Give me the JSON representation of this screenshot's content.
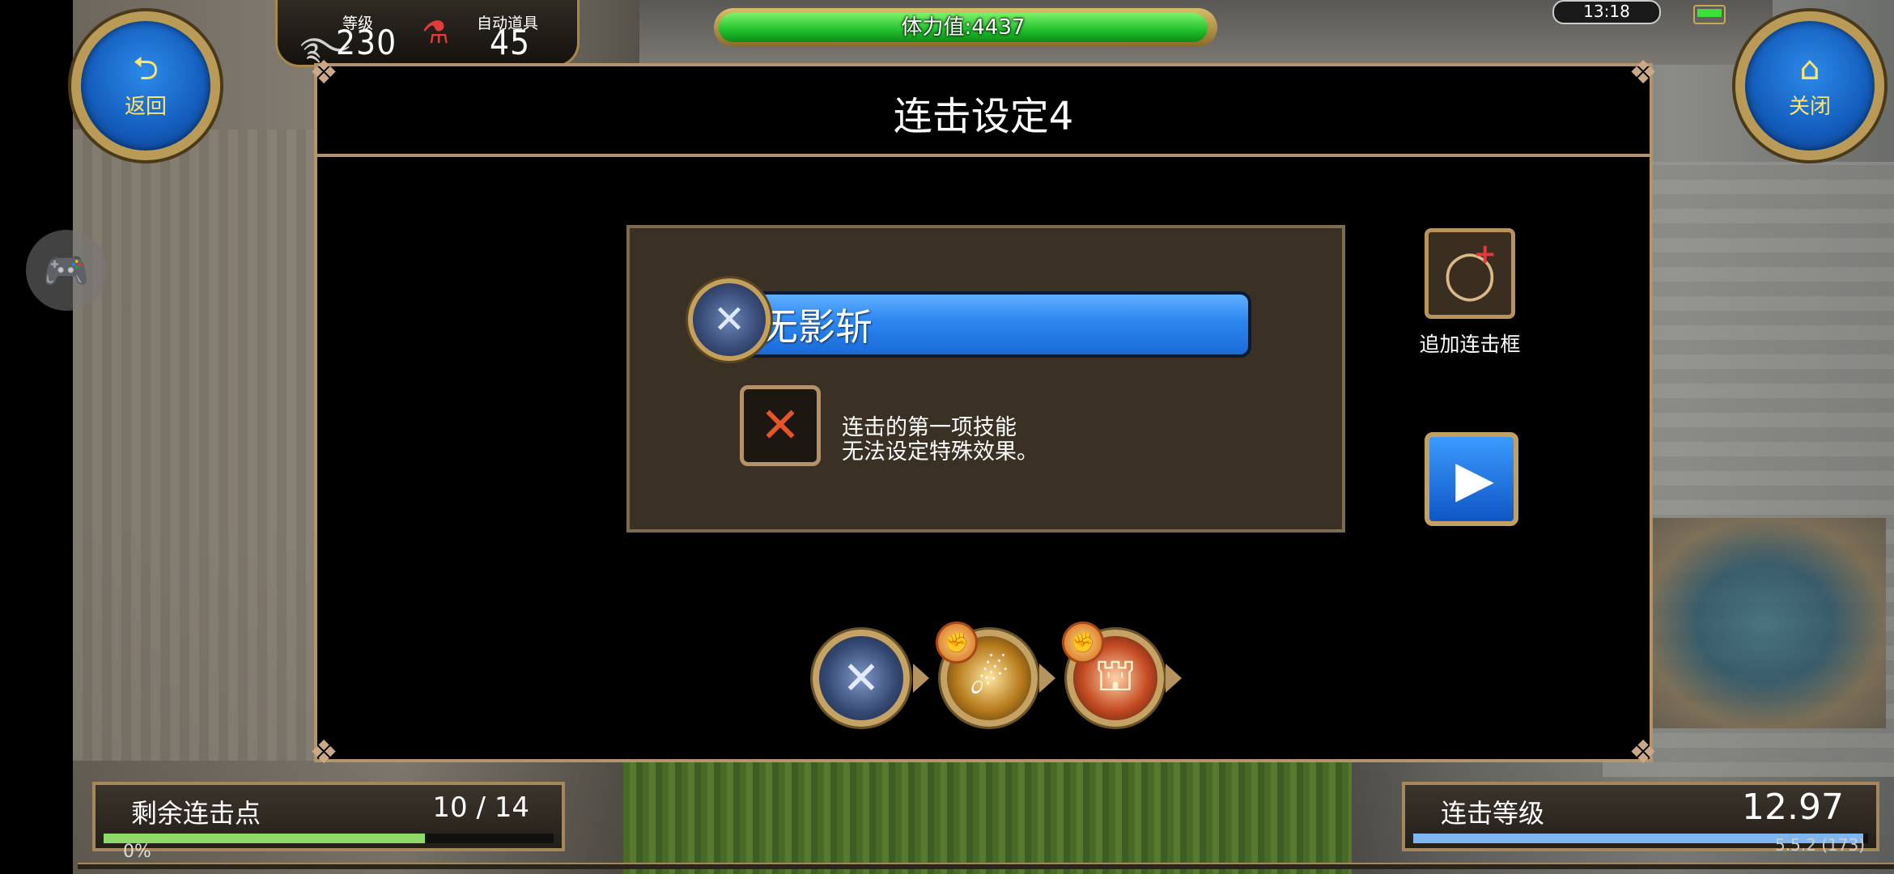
{
  "hud": {
    "back_label": "返回",
    "close_label": "关闭",
    "level_caption": "等级",
    "level_value": "230",
    "auto_item_caption": "自动道具",
    "auto_item_value": "45",
    "stamina_text": "体力值:4437",
    "stamina_fill": 0.99,
    "time": "13:18"
  },
  "dialog": {
    "title": "连击设定4",
    "first_skill_name": "无影斩",
    "note_line1": "连击的第一项技能",
    "note_line2": "无法设定特殊效果。",
    "add_frame_label": "追加连击框"
  },
  "bottom": {
    "points_label": "剩余连击点",
    "points_value": "10 / 14",
    "points_fill": 0.714,
    "level_label": "连击等级",
    "level_value": "12.97",
    "level_fill": 0.99,
    "exp_text": "0%",
    "version_text": "5.5.2 (173)"
  },
  "colors": {
    "gold_border": "#b4946b",
    "skill_bar_blue": "#2c86f0",
    "stamina_green": "#1fbf2b",
    "points_bar": "#8fd86a",
    "level_bar": "#7fb6f0"
  },
  "icons": {
    "back": "back-arrow-icon",
    "close": "home-icon",
    "auto_item": "potion-flask-icon",
    "add_frame": "add-circle-icon",
    "remove": "close-x-icon",
    "play": "play-icon",
    "chain": [
      "slash-skill-icon",
      "comet-skill-icon",
      "dome-skill-icon"
    ]
  }
}
